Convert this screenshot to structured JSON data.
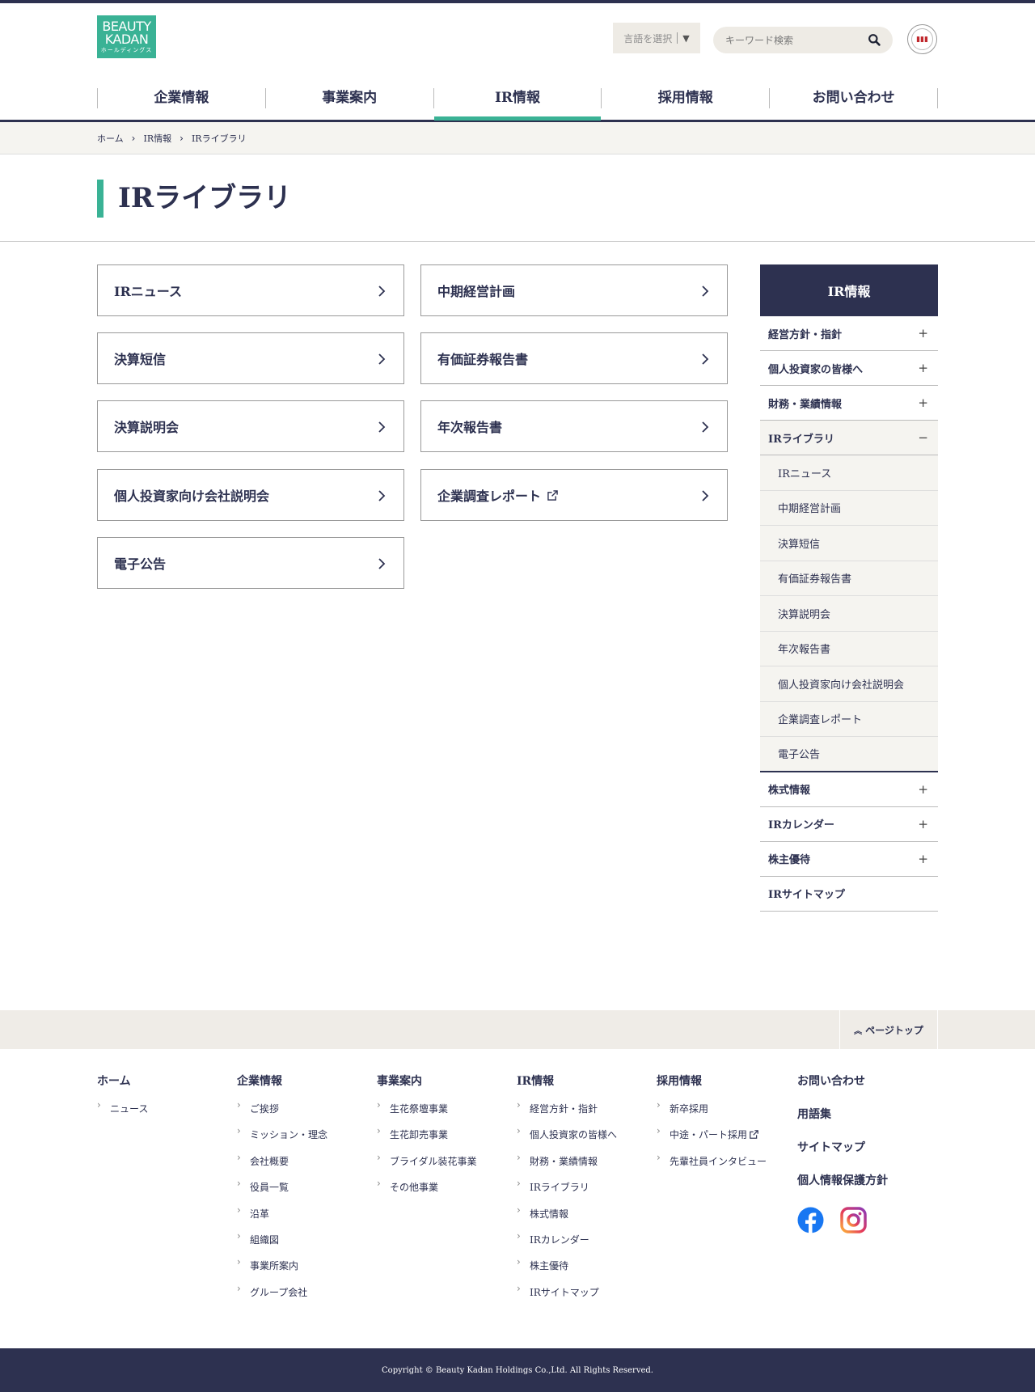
{
  "header": {
    "logo_line1": "BEAUTY",
    "logo_line2": "KADAN",
    "logo_line3": "ホールディングス",
    "lang_label": "言語を選択",
    "lang_arrow": "▼",
    "search_placeholder": "キーワード検索",
    "search_icon": "search-icon",
    "badge_icon": "certification-badge-icon"
  },
  "nav": [
    "企業情報",
    "事業案内",
    "IR情報",
    "採用情報",
    "お問い合わせ"
  ],
  "nav_active": "IR情報",
  "breadcrumb": [
    "ホーム",
    "IR情報",
    "IRライブラリ"
  ],
  "page_title": "IRライブラリ",
  "cards": [
    {
      "label": "IRニュース"
    },
    {
      "label": "中期経営計画"
    },
    {
      "label": "決算短信"
    },
    {
      "label": "有価証券報告書"
    },
    {
      "label": "決算説明会"
    },
    {
      "label": "年次報告書"
    },
    {
      "label": "個人投資家向け会社説明会"
    },
    {
      "label": "企業調査レポート",
      "external": true
    },
    {
      "label": "電子公告"
    }
  ],
  "sidebar": {
    "heading": "IR情報",
    "items_before": [
      "経営方針・指針",
      "個人投資家の皆様へ",
      "財務・業績情報"
    ],
    "open_item": "IRライブラリ",
    "sub_items": [
      "IRニュース",
      "中期経営計画",
      "決算短信",
      "有価証券報告書",
      "決算説明会",
      "年次報告書",
      "個人投資家向け会社説明会",
      "企業調査レポート",
      "電子公告"
    ],
    "items_after": [
      "株式情報",
      "IRカレンダー",
      "株主優待"
    ],
    "last_item": "IRサイトマップ",
    "plus": "+",
    "minus": "−"
  },
  "page_top": "ページトップ",
  "footer": {
    "col1": {
      "heading": "ホーム",
      "items": [
        "ニュース"
      ]
    },
    "col2": {
      "heading": "企業情報",
      "items": [
        "ご挨拶",
        "ミッション・理念",
        "会社概要",
        "役員一覧",
        "沿革",
        "組織図",
        "事業所案内",
        "グループ会社"
      ]
    },
    "col3": {
      "heading": "事業案内",
      "items": [
        "生花祭壇事業",
        "生花卸売事業",
        "ブライダル装花事業",
        "その他事業"
      ]
    },
    "col4": {
      "heading": "IR情報",
      "items": [
        "経営方針・指針",
        "個人投資家の皆様へ",
        "財務・業績情報",
        "IRライブラリ",
        "株式情報",
        "IRカレンダー",
        "株主優待",
        "IRサイトマップ"
      ]
    },
    "col5": {
      "heading": "採用情報",
      "items": [
        "新卒採用",
        "中途・パート採用",
        "先輩社員インタビュー"
      ]
    },
    "links": [
      "お問い合わせ",
      "用語集",
      "サイトマップ",
      "個人情報保護方針"
    ],
    "social": [
      "facebook-icon",
      "instagram-icon"
    ]
  },
  "copyright": "Copyright © Beauty Kadan Holdings Co.,Ltd. All Rights Reserved.",
  "colors": {
    "navy": "#2d3150",
    "accent": "#3ab295",
    "light_bg": "#f5f4f0"
  }
}
